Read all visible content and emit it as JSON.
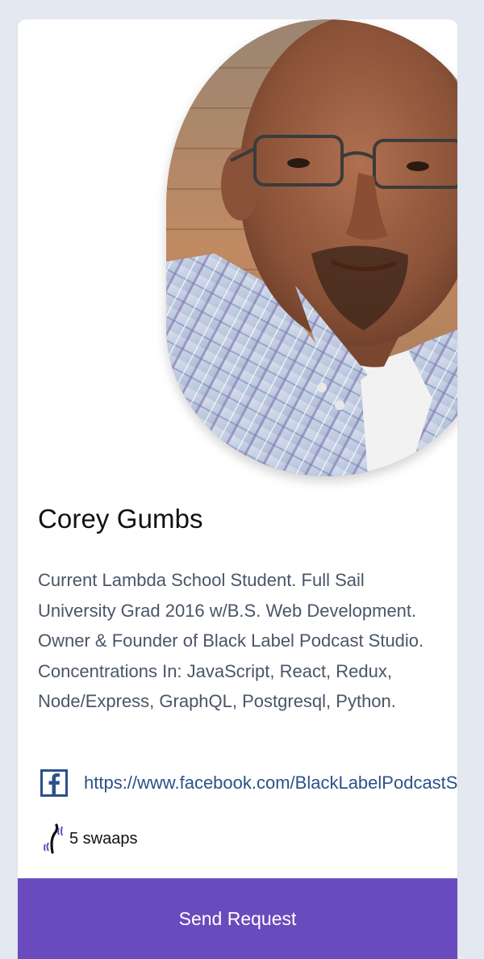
{
  "profile": {
    "name": "Corey Gumbs",
    "bio": "Current Lambda School Student. Full Sail University Grad 2016 w/B.S. Web Development. Owner & Founder of Black Label Podcast Studio. Concentrations In: JavaScript, React, Redux, Node/Express, GraphQL, Postgresql, Python.",
    "facebook_url": "https://www.facebook.com/BlackLabelPodcastStudio",
    "swaaps_text": "5 swaaps"
  },
  "actions": {
    "send_label": "Send Request"
  },
  "colors": {
    "button": "#6a4bbd",
    "link": "#2b5289",
    "bio_text": "#4a5568",
    "page_background": "#e4e8f0"
  },
  "icons": {
    "facebook": "facebook-icon",
    "swaap": "swaap-signal-icon"
  }
}
